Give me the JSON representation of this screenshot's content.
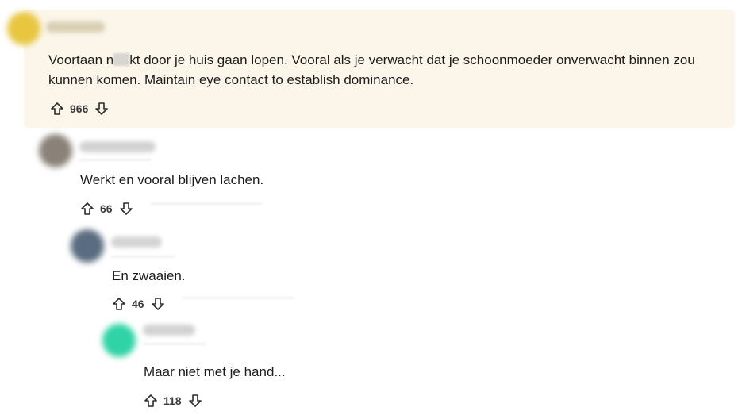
{
  "comments": [
    {
      "username": "",
      "text_before": "Voortaan n",
      "text_after": "kt door je huis gaan lopen. Vooral als je verwacht dat je schoonmoeder onverwacht binnen zou kunnen komen. Maintain eye contact to establish dominance.",
      "score": "966",
      "avatar_color": "#e8c640"
    },
    {
      "username": "",
      "text": "Werkt en vooral blijven lachen.",
      "score": "66",
      "avatar_color": "#8a8278"
    },
    {
      "username": "",
      "text": "En zwaaien.",
      "score": "46",
      "avatar_color": "#5a6c80"
    },
    {
      "username": "",
      "text": "Maar niet met je hand...",
      "score": "118",
      "avatar_color": "#2fd3a6"
    }
  ],
  "icons": {
    "upvote": "upvote-icon",
    "downvote": "downvote-icon"
  }
}
